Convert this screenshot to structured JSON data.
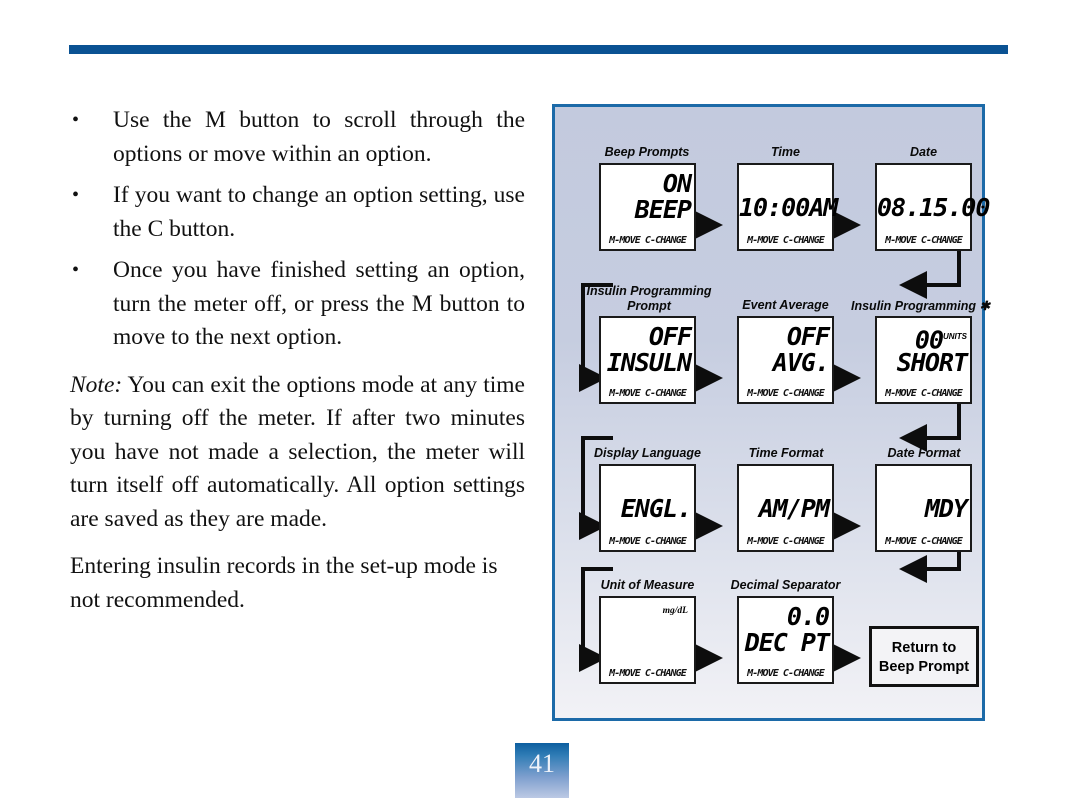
{
  "page": {
    "number": "41",
    "rule_color": "#0a5293",
    "panel_border_color": "#1c6aa8",
    "panel_bg_top": "#c3cade",
    "panel_bg_bottom": "#f2f2f6"
  },
  "text_column": {
    "bullets": [
      {
        "bullet": "•",
        "text": "Use the M button to scroll through the options or move within an option."
      },
      {
        "bullet": "•",
        "text": "If you want to change an option setting, use the C button."
      },
      {
        "bullet": "•",
        "text": "Once you have finished setting an option, turn the meter off, or press the M button to move to the next option."
      }
    ],
    "note_label": "Note:",
    "note_body": " You can exit the options mode at any time by turning off the meter. If after two minutes you have not made a selection, the meter will turn itself off automatically. All option settings are saved as they are made.",
    "closing_paragraph": "Entering insulin records in the set-up mode is not recommended."
  },
  "diagram": {
    "footer_hint": "M-MOVE C-CHANGE",
    "rows": [
      {
        "nodes": [
          {
            "caption": "Beep Prompts",
            "line1": "ON",
            "line2": "BEEP",
            "footer": "M-MOVE C-CHANGE"
          },
          {
            "caption": "Time",
            "line1": "",
            "line2": "10:00AM",
            "footer": "M-MOVE C-CHANGE"
          },
          {
            "caption": "Date",
            "line1": "",
            "line2": "08.15.00",
            "footer": "M-MOVE C-CHANGE"
          }
        ]
      },
      {
        "nodes": [
          {
            "caption": "Insulin Programming Prompt",
            "caption_line1": "Insulin Programming",
            "caption_line2": "Prompt",
            "line1": "OFF",
            "line2": "INSULN",
            "footer": "M-MOVE C-CHANGE"
          },
          {
            "caption": "Event Average",
            "line1": "OFF",
            "line2": "AVG.",
            "footer": "M-MOVE C-CHANGE"
          },
          {
            "caption": "Insulin Programming ✱",
            "line1": "00",
            "units": "UNITS",
            "line2": "SHORT",
            "footer": "M-MOVE C-CHANGE"
          }
        ]
      },
      {
        "nodes": [
          {
            "caption": "Display Language",
            "line1": "",
            "line2": "ENGL.",
            "footer": "M-MOVE C-CHANGE"
          },
          {
            "caption": "Time Format",
            "line1": "",
            "line2": "AM/PM",
            "footer": "M-MOVE C-CHANGE"
          },
          {
            "caption": "Date Format",
            "line1": "",
            "line2": "MDY",
            "footer": "M-MOVE C-CHANGE"
          }
        ]
      },
      {
        "nodes": [
          {
            "caption": "Unit of Measure",
            "line1": "",
            "line2": "",
            "unit_badge": "mg/dL",
            "footer": "M-MOVE C-CHANGE"
          },
          {
            "caption": "Decimal Separator",
            "line1": "0.0",
            "line2": "DEC PT",
            "footer": "M-MOVE C-CHANGE"
          },
          {
            "caption": "",
            "return_line1": "Return to",
            "return_line2": "Beep Prompt"
          }
        ]
      }
    ]
  }
}
